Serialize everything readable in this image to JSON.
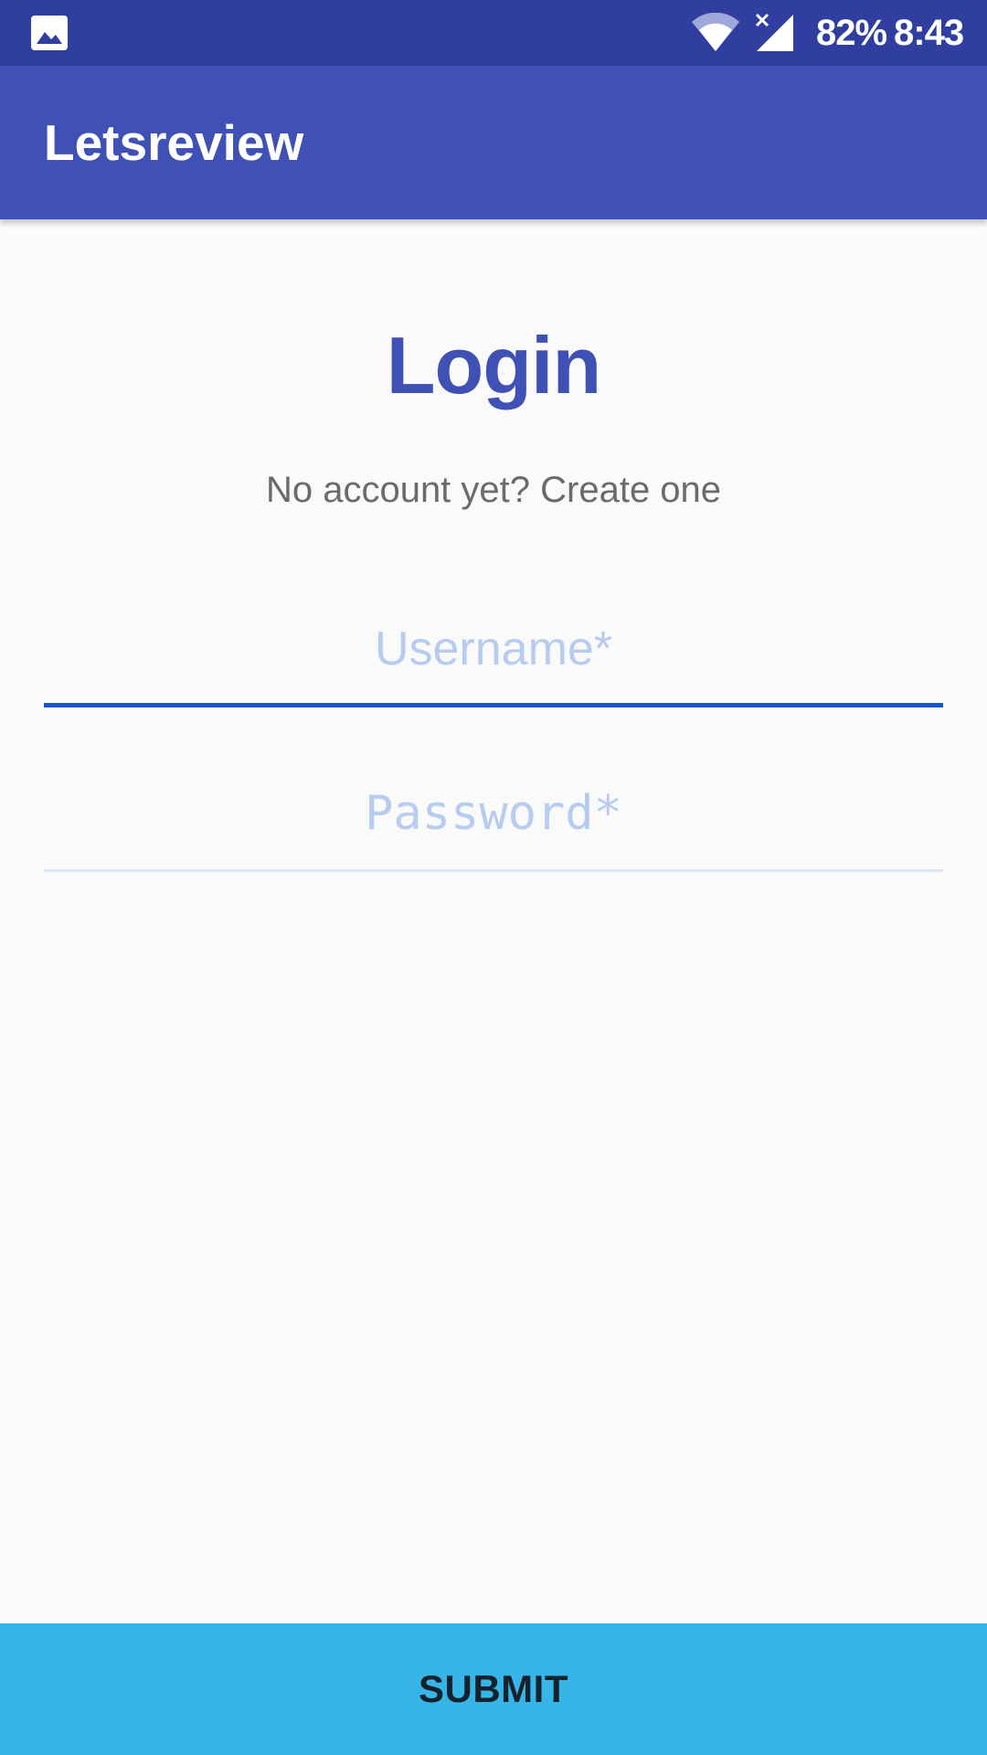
{
  "status_bar": {
    "notification_icon": "image-icon",
    "wifi_icon": "wifi-icon",
    "signal_icon": "cellular-signal-icon",
    "battery": "82%",
    "time": "8:43"
  },
  "app_bar": {
    "title": "Letsreview"
  },
  "login": {
    "heading": "Login",
    "create_account_link": "No account yet? Create one",
    "username": {
      "placeholder": "Username*",
      "value": ""
    },
    "password": {
      "placeholder": "Password*",
      "value": ""
    },
    "submit_label": "SUBMIT"
  },
  "colors": {
    "status_bar": "#303f9f",
    "app_bar": "#3f51b5",
    "heading": "#3f51b5",
    "background": "#fafafa",
    "active_underline": "#1a56c8",
    "placeholder": "#b7ccee",
    "submit_button": "#37b5e6"
  }
}
